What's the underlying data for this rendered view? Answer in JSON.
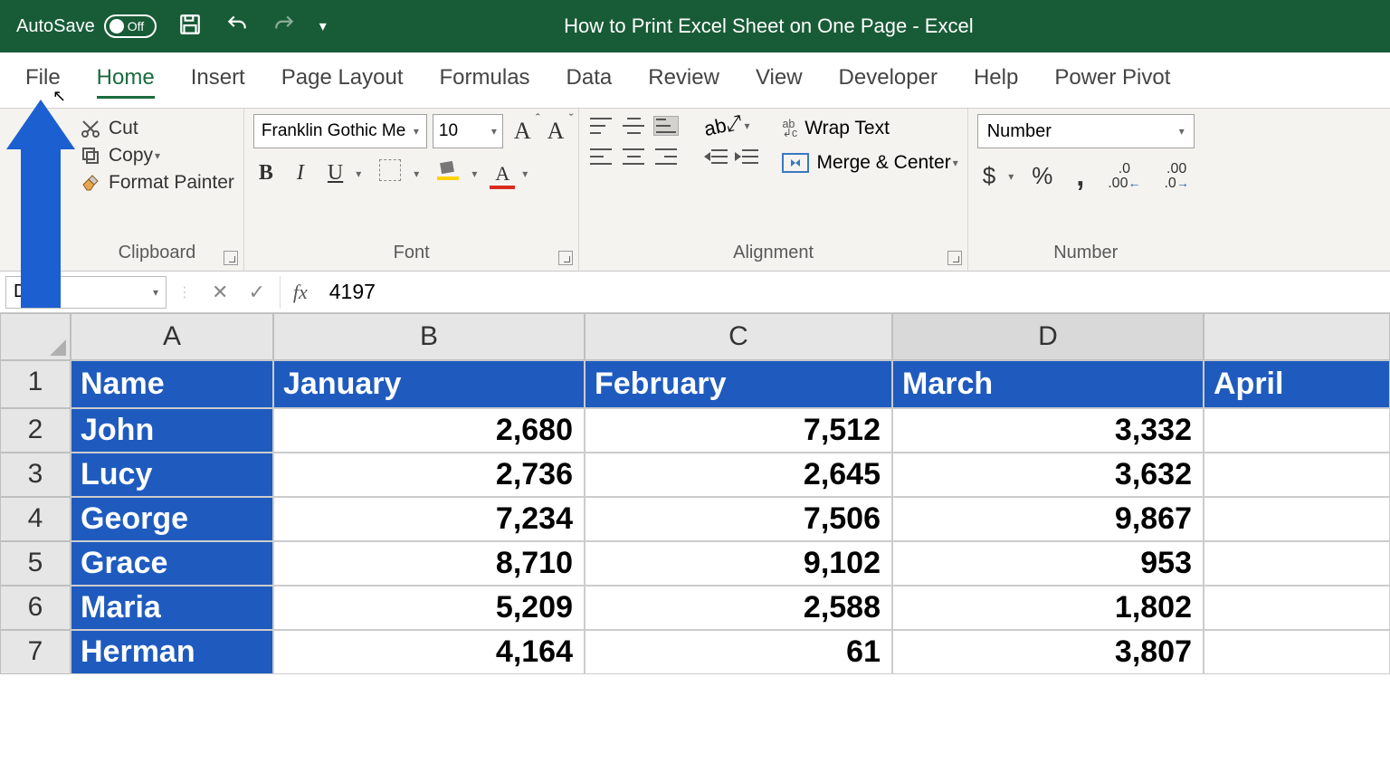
{
  "titlebar": {
    "autosave": "AutoSave",
    "toggle": "Off",
    "doc_title": "How to Print Excel Sheet on One Page  -  Excel"
  },
  "tabs": [
    "File",
    "Home",
    "Insert",
    "Page Layout",
    "Formulas",
    "Data",
    "Review",
    "View",
    "Developer",
    "Help",
    "Power Pivot"
  ],
  "active_tab": 1,
  "ribbon": {
    "clipboard": {
      "cut": "Cut",
      "copy": "Copy",
      "painter": "Format Painter",
      "label": "Clipboard"
    },
    "font": {
      "name": "Franklin Gothic Me",
      "size": "10",
      "bold": "B",
      "italic": "I",
      "underline": "U",
      "fontA": "A",
      "label": "Font"
    },
    "alignment": {
      "wrap": "Wrap Text",
      "merge": "Merge & Center",
      "label": "Alignment"
    },
    "number": {
      "format": "Number",
      "label": "Number",
      "dollar": "$",
      "percent": "%",
      "comma": ","
    }
  },
  "formula_bar": {
    "namebox": "D10",
    "value": "4197"
  },
  "columns": [
    "A",
    "B",
    "C",
    "D"
  ],
  "selected_col_index": 3,
  "headers": [
    "Name",
    "January",
    "February",
    "March",
    "April"
  ],
  "rows": [
    {
      "name": "John",
      "vals": [
        "2,680",
        "7,512",
        "3,332"
      ]
    },
    {
      "name": "Lucy",
      "vals": [
        "2,736",
        "2,645",
        "3,632"
      ]
    },
    {
      "name": "George",
      "vals": [
        "7,234",
        "7,506",
        "9,867"
      ]
    },
    {
      "name": "Grace",
      "vals": [
        "8,710",
        "9,102",
        "953"
      ]
    },
    {
      "name": "Maria",
      "vals": [
        "5,209",
        "2,588",
        "1,802"
      ]
    },
    {
      "name": "Herman",
      "vals": [
        "4,164",
        "61",
        "3,807"
      ]
    }
  ],
  "chart_data": {
    "type": "table",
    "headers": [
      "Name",
      "January",
      "February",
      "March"
    ],
    "rows": [
      [
        "John",
        2680,
        7512,
        3332
      ],
      [
        "Lucy",
        2736,
        2645,
        3632
      ],
      [
        "George",
        7234,
        7506,
        9867
      ],
      [
        "Grace",
        8710,
        9102,
        953
      ],
      [
        "Maria",
        5209,
        2588,
        1802
      ],
      [
        "Herman",
        4164,
        61,
        3807
      ]
    ]
  }
}
